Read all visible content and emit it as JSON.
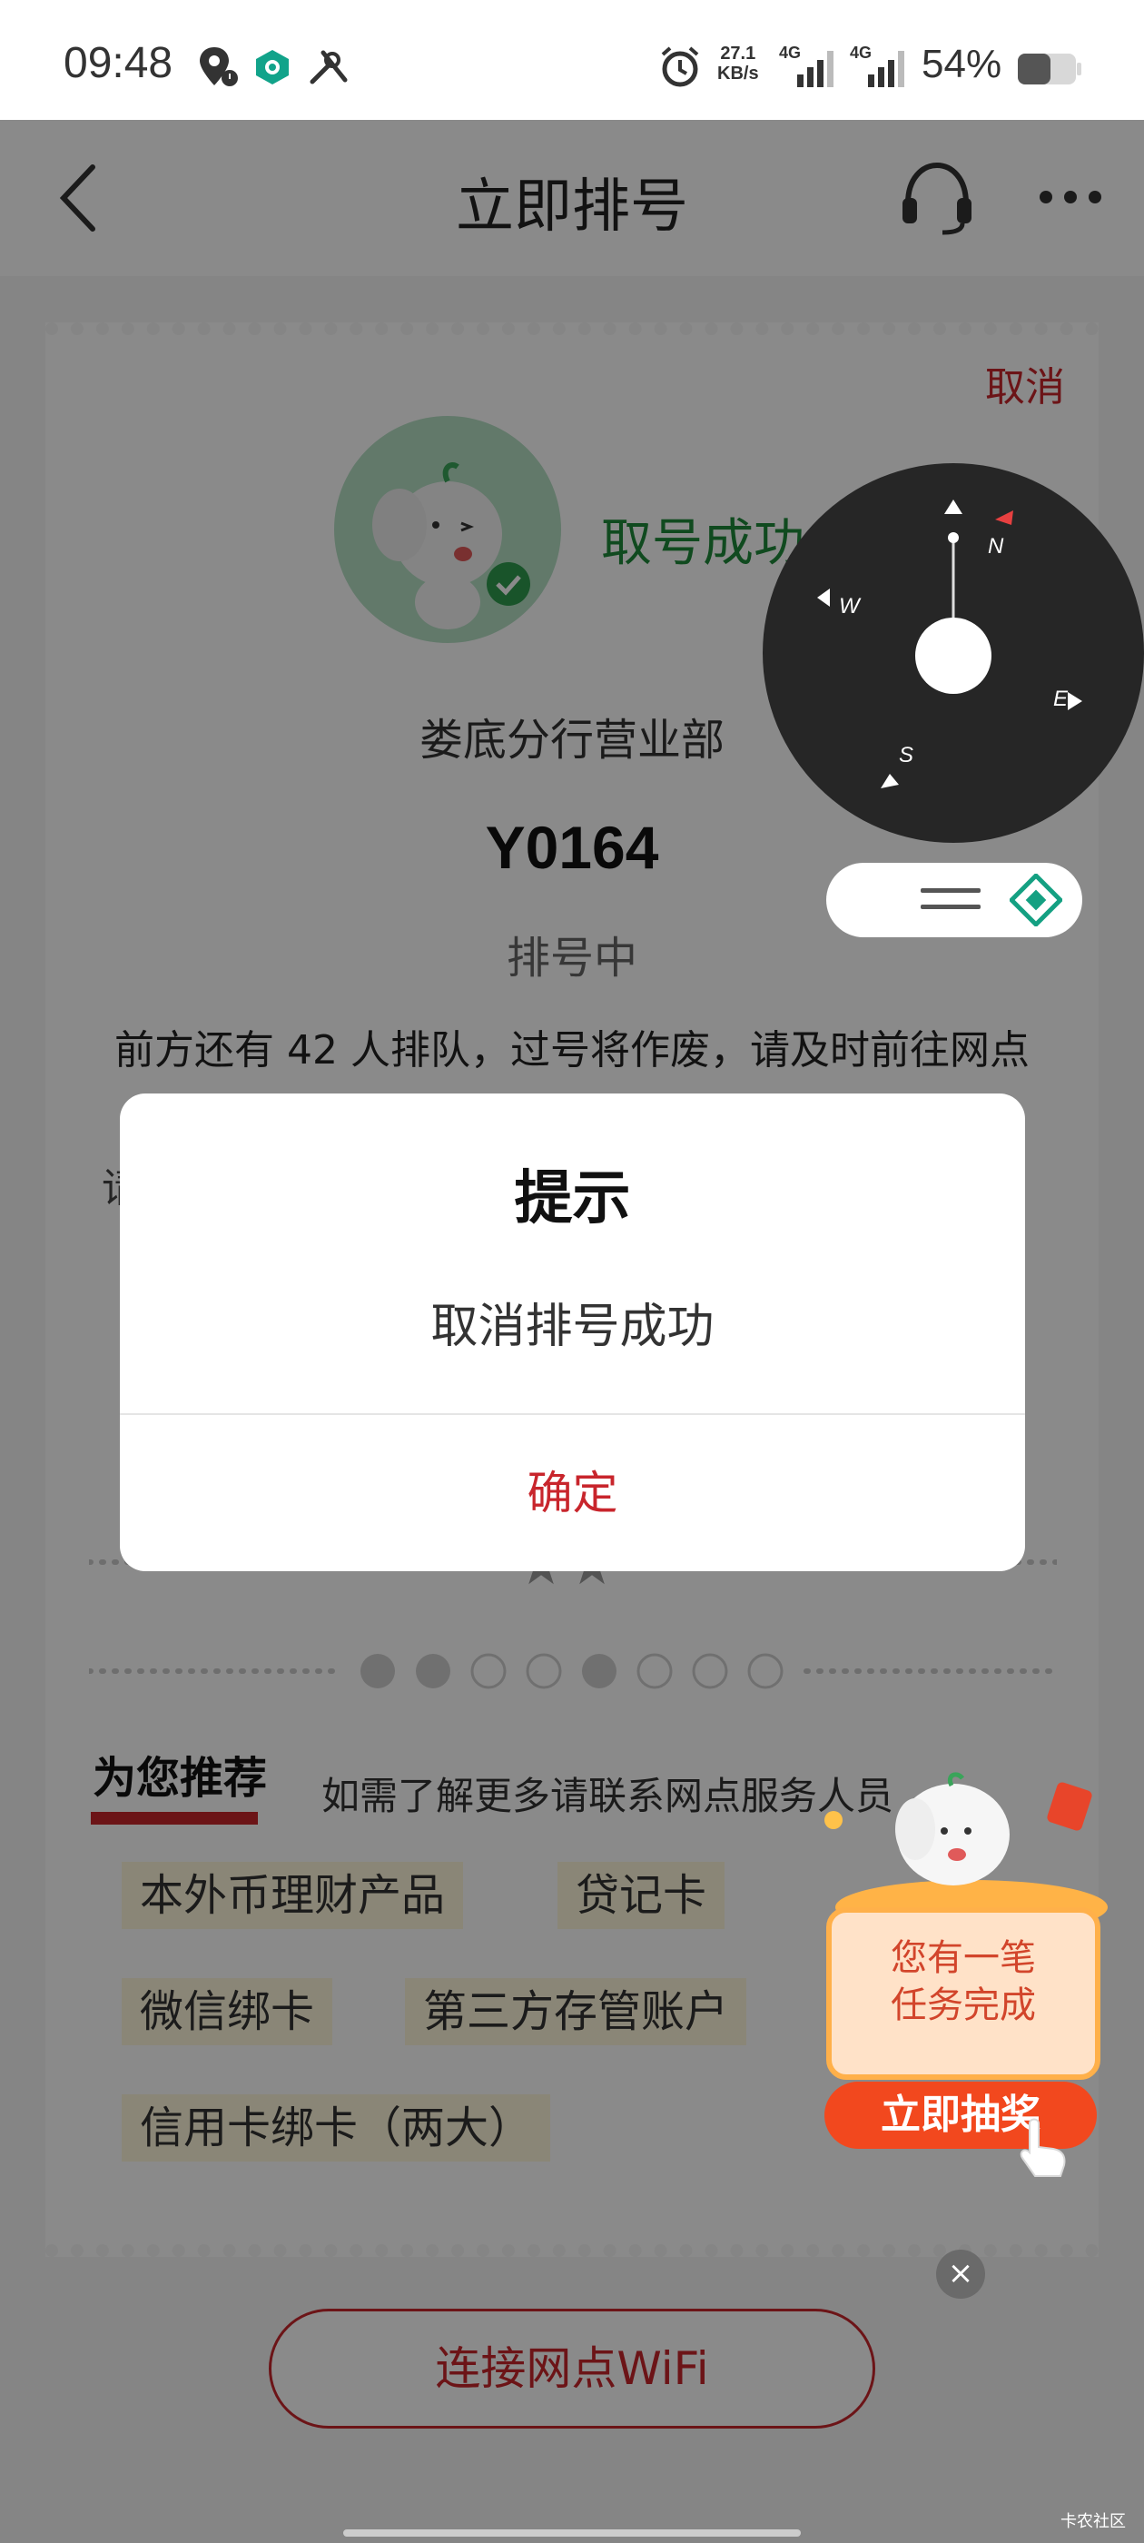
{
  "status_bar": {
    "time": "09:48",
    "network_speed_value": "27.1",
    "network_speed_unit": "KB/s",
    "network_type_1": "4G",
    "network_type_2": "4G",
    "battery": "54%",
    "icons": [
      "location-icon",
      "shield-app-icon",
      "tools-icon",
      "alarm-icon",
      "signal-icon",
      "battery-icon"
    ]
  },
  "nav": {
    "title": "立即排号",
    "icons": [
      "back-icon",
      "headset-icon",
      "more-icon"
    ]
  },
  "card": {
    "cancel_label": "取消",
    "success_text": "取号成功",
    "branch_name": "娄底分行营业部",
    "ticket_number": "Y0164",
    "status": "排号中",
    "queue_info": "前方还有 42 人排队，过号将作废，请及时前往网点",
    "partial_text": "请",
    "stars": "★★"
  },
  "recommend": {
    "title": "为您推荐",
    "note": "如需了解更多请联系网点服务人员",
    "tags": [
      "本外币理财产品",
      "贷记卡",
      "微信绑卡",
      "第三方存管账户",
      "信用卡绑卡（两大）"
    ]
  },
  "wifi_button": "连接网点WiFi",
  "modal": {
    "title": "提示",
    "message": "取消排号成功",
    "confirm": "确定"
  },
  "compass": {
    "north": "N",
    "south": "S",
    "east": "E",
    "west": "W"
  },
  "promo": {
    "line1": "您有一笔",
    "line2": "任务完成",
    "button": "立即抽奖",
    "close": "×"
  },
  "watermark": "卡农社区",
  "colors": {
    "accent_red": "#c8252c",
    "success_green": "#1f8a3a",
    "tag_bg": "#fff8dc",
    "overlay": "rgba(0,0,0,0.46)"
  }
}
